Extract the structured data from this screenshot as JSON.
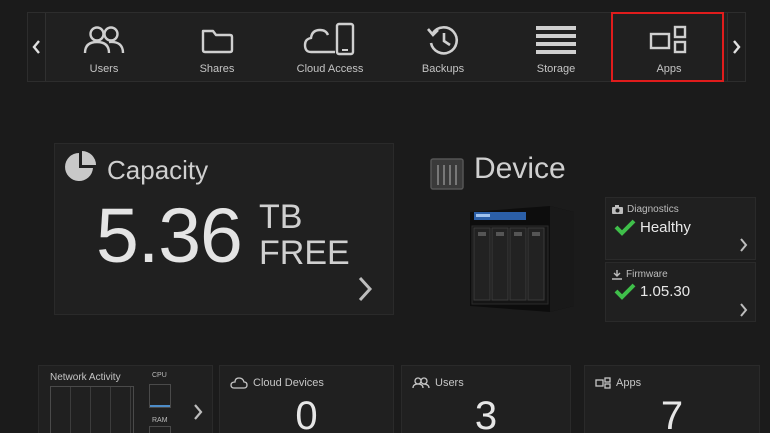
{
  "nav": {
    "items": [
      {
        "label": "Users",
        "icon": "users-icon"
      },
      {
        "label": "Shares",
        "icon": "folder-icon"
      },
      {
        "label": "Cloud Access",
        "icon": "cloud-phone-icon"
      },
      {
        "label": "Backups",
        "icon": "history-icon"
      },
      {
        "label": "Storage",
        "icon": "storage-icon"
      },
      {
        "label": "Apps",
        "icon": "apps-icon"
      }
    ],
    "highlighted": "Apps",
    "highlight_color": "#e01c1c"
  },
  "capacity": {
    "title": "Capacity",
    "value": "5.36",
    "unit": "TB",
    "suffix": "FREE"
  },
  "device": {
    "title": "Device",
    "diagnostics": {
      "label": "Diagnostics",
      "status": "Healthy"
    },
    "firmware": {
      "label": "Firmware",
      "version": "1.05.30"
    },
    "status_color": "#3fbf4a"
  },
  "network": {
    "label": "Network Activity",
    "cpu_label": "CPU",
    "ram_label": "RAM",
    "cpu_level": 0.08
  },
  "stats": [
    {
      "label": "Cloud Devices",
      "value": "0",
      "icon": "cloud-icon"
    },
    {
      "label": "Users",
      "value": "3",
      "icon": "users-icon"
    },
    {
      "label": "Apps",
      "value": "7",
      "icon": "apps-icon"
    }
  ]
}
